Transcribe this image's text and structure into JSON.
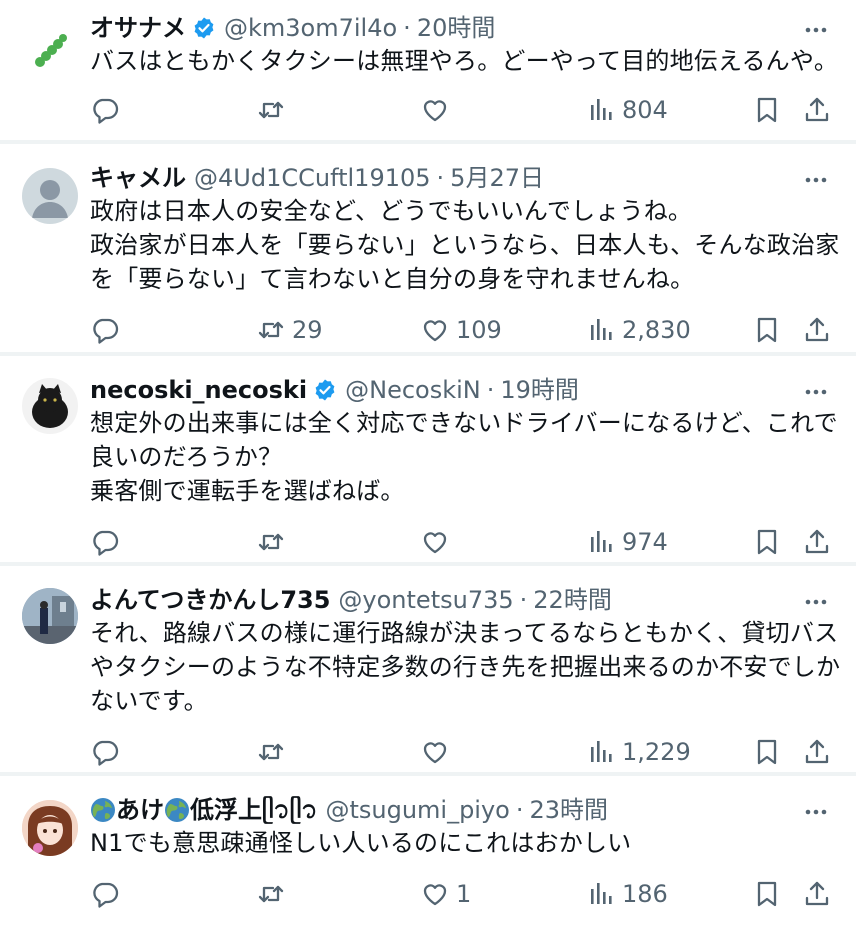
{
  "tweets": [
    {
      "name": "オサナメ",
      "verified": true,
      "handle": "@km3om7il4o",
      "time": "20時間",
      "lines": [
        "バスはともかくタクシーは無理やろ。どーやって目的地伝えるんや。"
      ],
      "replies": "",
      "retweets": "",
      "likes": "",
      "views": "804"
    },
    {
      "name": "キャメル",
      "verified": false,
      "handle": "@4Ud1CCuftl19105",
      "time": "5月27日",
      "lines": [
        "政府は日本人の安全など、どうでもいいんでしょうね。",
        "政治家が日本人を「要らない」というなら、日本人も、そんな政治家",
        "を「要らない」て言わないと自分の身を守れませんね。"
      ],
      "replies": "",
      "retweets": "29",
      "likes": "109",
      "views": "2,830"
    },
    {
      "name": "necoski_necoski",
      "verified": true,
      "handle": "@NecoskiN",
      "time": "19時間",
      "lines": [
        "想定外の出来事には全く対応できないドライバーになるけど、これで",
        "良いのだろうか？",
        "乗客側で運転手を選ばねば。"
      ],
      "replies": "",
      "retweets": "",
      "likes": "",
      "views": "974"
    },
    {
      "name": "よんてつきかんし735",
      "verified": false,
      "handle": "@yontetsu735",
      "time": "22時間",
      "lines": [
        "それ、路線バスの様に運行路線が決まってるならともかく、貸切バス",
        "やタクシーのような不特定多数の行き先を把握出来るのか不安でしか",
        "ないです。"
      ],
      "replies": "",
      "retweets": "",
      "likes": "",
      "views": "1,229"
    },
    {
      "name": "あけ",
      "name2": "低浮上",
      "name_suffix": "ᥫ᭡ᥫ᭡",
      "verified": false,
      "handle": "@tsugumi_piyo",
      "time": "23時間",
      "lines": [
        "N1でも意思疎通怪しい人いるのにこれはおかしい"
      ],
      "replies": "",
      "retweets": "",
      "likes": "1",
      "views": "186"
    }
  ],
  "icons": {
    "reply": "reply-icon",
    "retweet": "retweet-icon",
    "like": "heart-icon",
    "views": "views-icon",
    "bookmark": "bookmark-icon",
    "share": "share-icon",
    "more": "more-icon",
    "verified": "verified-badge-icon",
    "earth": "earth-globe-emoji"
  },
  "colors": {
    "text": "#0f1419",
    "secondary": "#536471",
    "verified": "#1d9bf0",
    "separator": "#eff3f4"
  }
}
